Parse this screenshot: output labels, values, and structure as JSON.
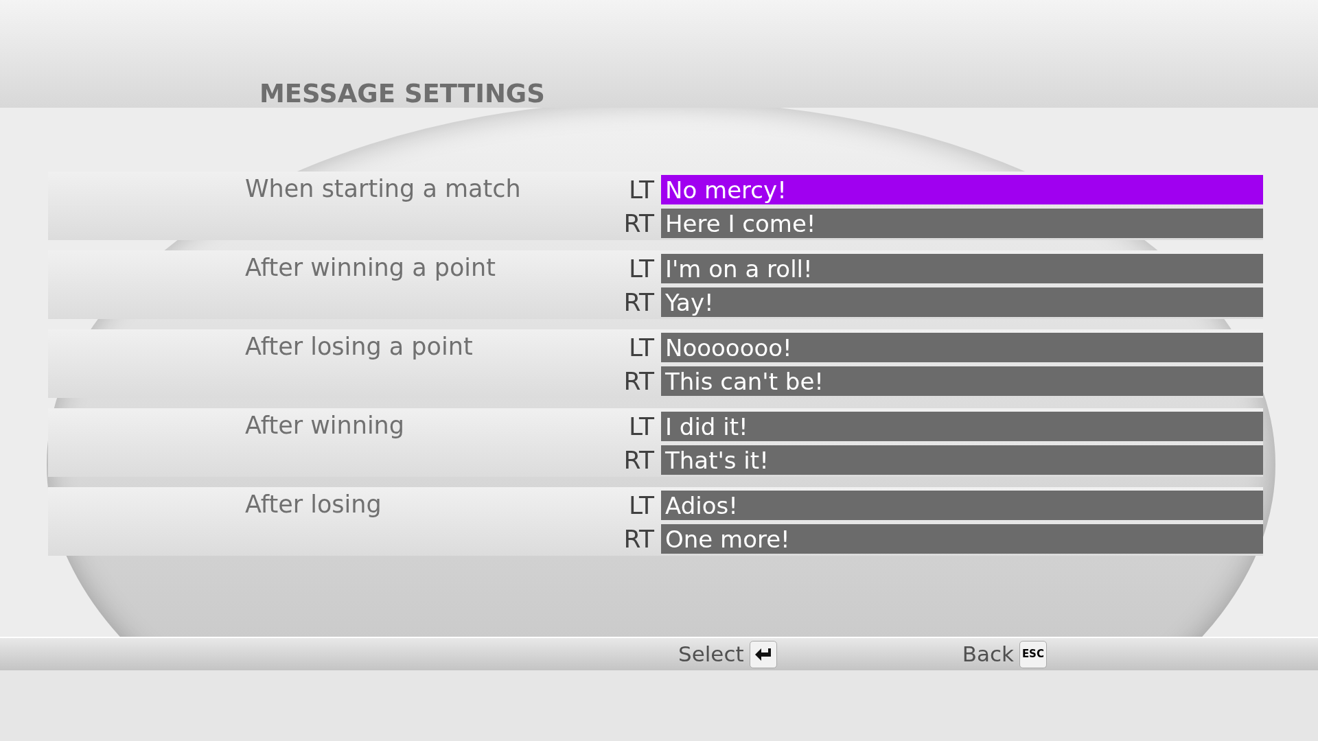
{
  "title": "MESSAGE SETTINGS",
  "groups": [
    {
      "label": "When starting a match",
      "slots": [
        {
          "trigger": "LT",
          "message": "No mercy!",
          "selected": true
        },
        {
          "trigger": "RT",
          "message": "Here I come!",
          "selected": false
        }
      ]
    },
    {
      "label": "After winning a point",
      "slots": [
        {
          "trigger": "LT",
          "message": "I'm on a roll!",
          "selected": false
        },
        {
          "trigger": "RT",
          "message": "Yay!",
          "selected": false
        }
      ]
    },
    {
      "label": "After losing a point",
      "slots": [
        {
          "trigger": "LT",
          "message": "Nooooooo!",
          "selected": false
        },
        {
          "trigger": "RT",
          "message": "This can't be!",
          "selected": false
        }
      ]
    },
    {
      "label": "After winning",
      "slots": [
        {
          "trigger": "LT",
          "message": "I did it!",
          "selected": false
        },
        {
          "trigger": "RT",
          "message": "That's it!",
          "selected": false
        }
      ]
    },
    {
      "label": "After losing",
      "slots": [
        {
          "trigger": "LT",
          "message": "Adios!",
          "selected": false
        },
        {
          "trigger": "RT",
          "message": "One more!",
          "selected": false
        }
      ]
    }
  ],
  "footer": [
    {
      "kind": "enter",
      "label": "Select"
    },
    {
      "kind": "esc",
      "label": "Back",
      "key": "ESC"
    }
  ]
}
